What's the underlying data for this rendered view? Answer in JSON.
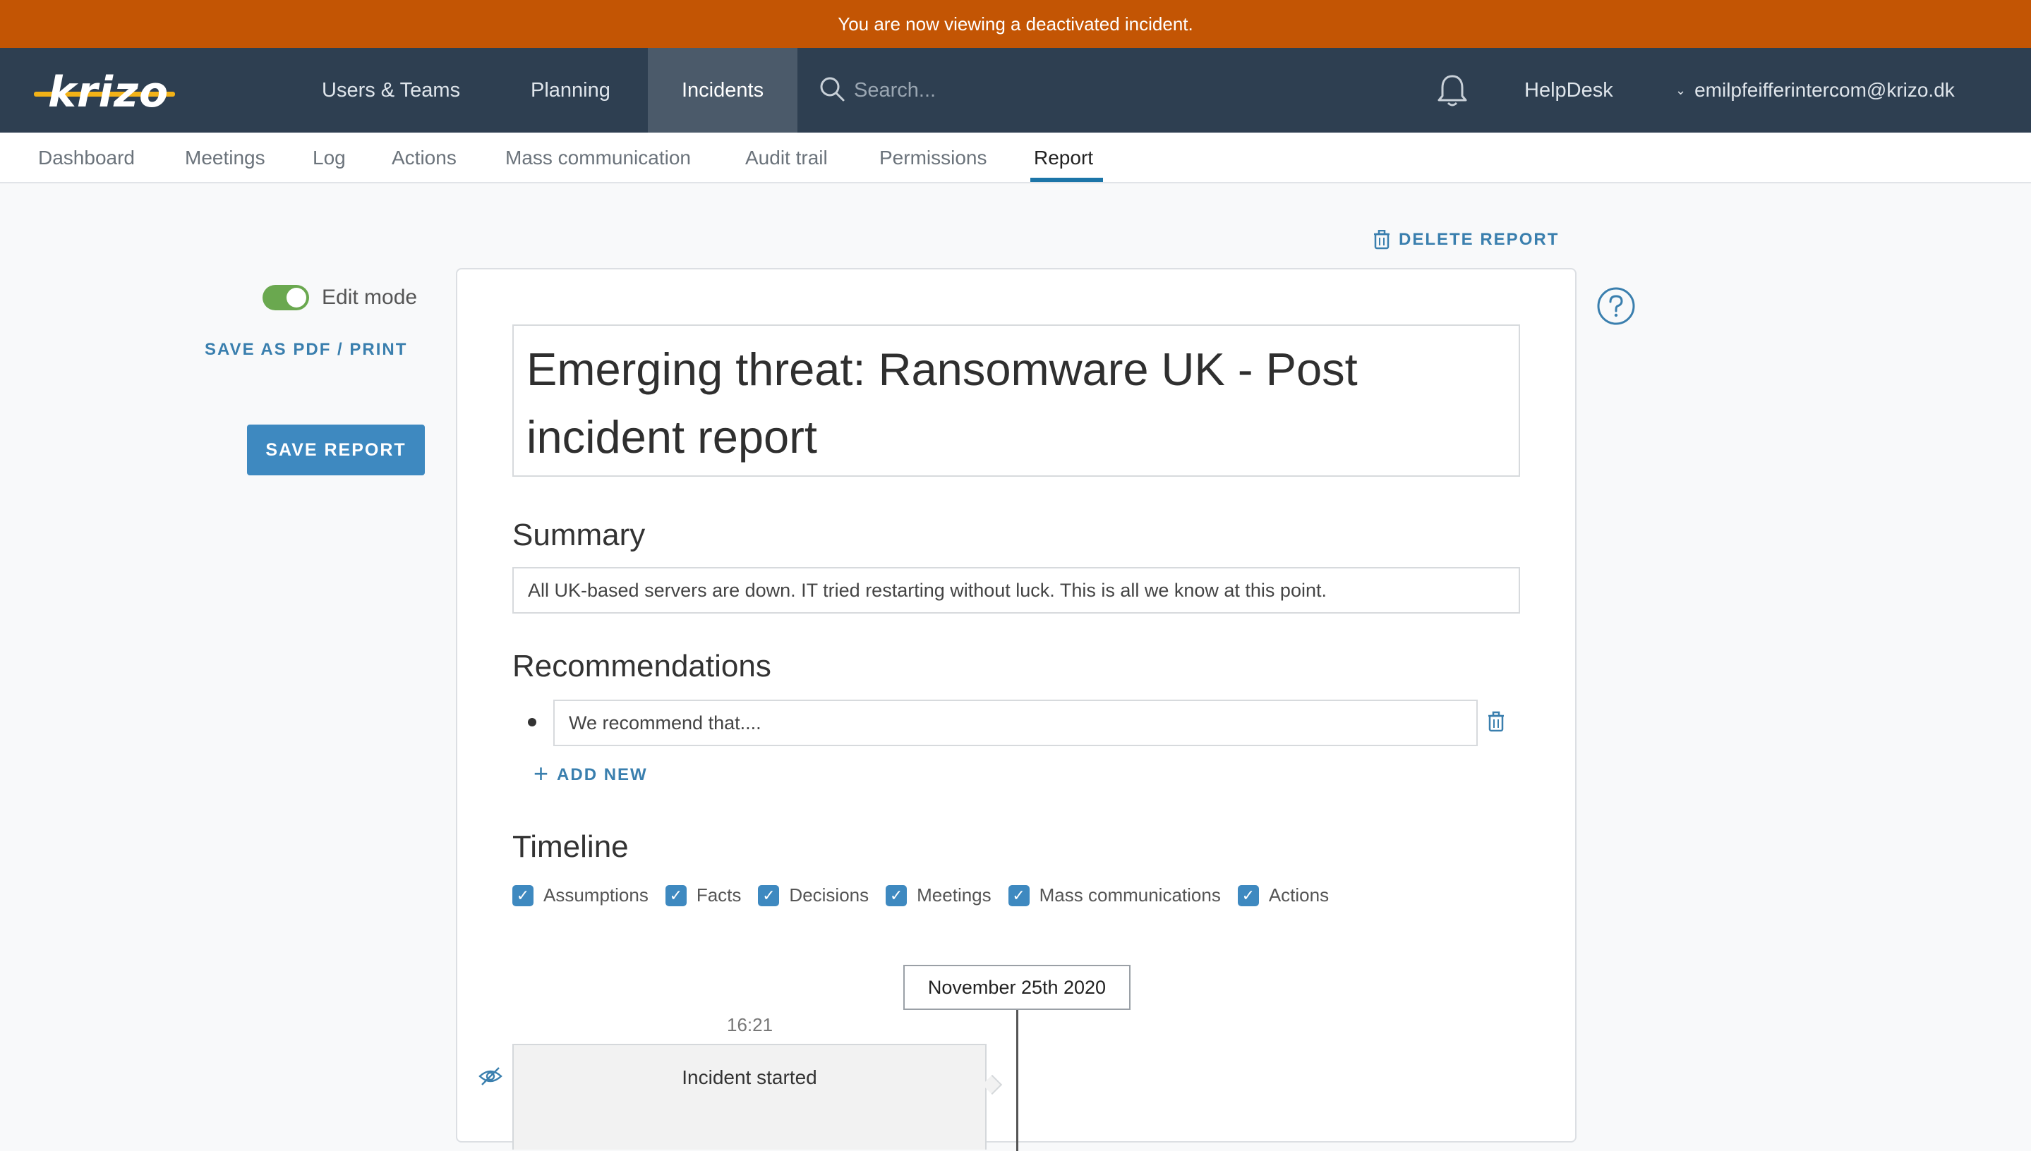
{
  "banner": {
    "text": "You are now viewing a deactivated incident."
  },
  "logo": {
    "text": "krizo"
  },
  "nav": {
    "items": [
      {
        "label": "Users & Teams"
      },
      {
        "label": "Planning"
      },
      {
        "label": "Incidents",
        "active": true
      }
    ],
    "search_placeholder": "Search...",
    "helpdesk": "HelpDesk",
    "user_email": "emilpfeifferintercom@krizo.dk",
    "user_chevron": "⌄"
  },
  "subnav": {
    "items": [
      {
        "label": "Dashboard"
      },
      {
        "label": "Meetings"
      },
      {
        "label": "Log"
      },
      {
        "label": "Actions"
      },
      {
        "label": "Mass communication"
      },
      {
        "label": "Audit trail"
      },
      {
        "label": "Permissions"
      },
      {
        "label": "Report",
        "active": true
      }
    ]
  },
  "sidebar": {
    "edit_mode_label": "Edit mode",
    "edit_mode_on": true,
    "save_pdf": "SAVE AS PDF / PRINT",
    "save_report": "SAVE REPORT"
  },
  "report": {
    "delete_label": "DELETE REPORT",
    "title": "Emerging threat: Ransomware UK - Post incident report",
    "summary_heading": "Summary",
    "summary_text": "All UK-based servers are down. IT tried restarting without luck. This is all we know at this point.",
    "recommendations_heading": "Recommendations",
    "recommendations": [
      {
        "text": "We recommend that...."
      }
    ],
    "add_new": "ADD NEW",
    "timeline_heading": "Timeline",
    "filters": [
      {
        "label": "Assumptions",
        "checked": true
      },
      {
        "label": "Facts",
        "checked": true
      },
      {
        "label": "Decisions",
        "checked": true
      },
      {
        "label": "Meetings",
        "checked": true
      },
      {
        "label": "Mass communications",
        "checked": true
      },
      {
        "label": "Actions",
        "checked": true
      }
    ],
    "timeline_date": "November 25th 2020",
    "events": [
      {
        "time": "16:21",
        "title": "Incident started"
      }
    ]
  },
  "colors": {
    "banner": "#c35504",
    "navbar": "#2e3f51",
    "accent": "#3e89c0",
    "toggle_on": "#6aa84f",
    "logo_strike": "#f2b217"
  }
}
